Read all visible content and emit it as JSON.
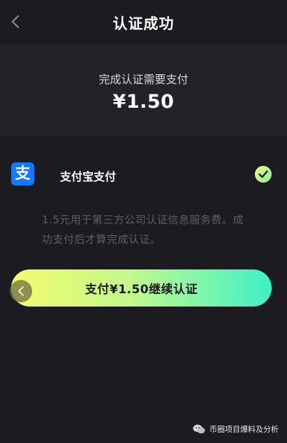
{
  "header": {
    "title": "认证成功"
  },
  "summary": {
    "label": "完成认证需要支付",
    "amount": "¥1.50"
  },
  "payment_method": {
    "icon_text": "支",
    "label": "支付宝支付",
    "selected": true
  },
  "note": "1.5元用于第三方公司认证信息服务费。成功支付后才算完成认证。",
  "pay_button": {
    "label": "支付¥1.50继续认证"
  },
  "watermark": {
    "text": "币圈项目爆料及分析"
  },
  "colors": {
    "background": "#1c1c20",
    "panel": "#232327",
    "alipay_blue": "#1677ff",
    "gradient_start": "#f4fb6e",
    "gradient_end": "#3ef0c6",
    "note_text": "#5e5e63"
  },
  "icons": {
    "back": "chevron-left-icon",
    "check": "check-icon",
    "floating_back": "chevron-left-icon",
    "wechat": "wechat-icon"
  }
}
